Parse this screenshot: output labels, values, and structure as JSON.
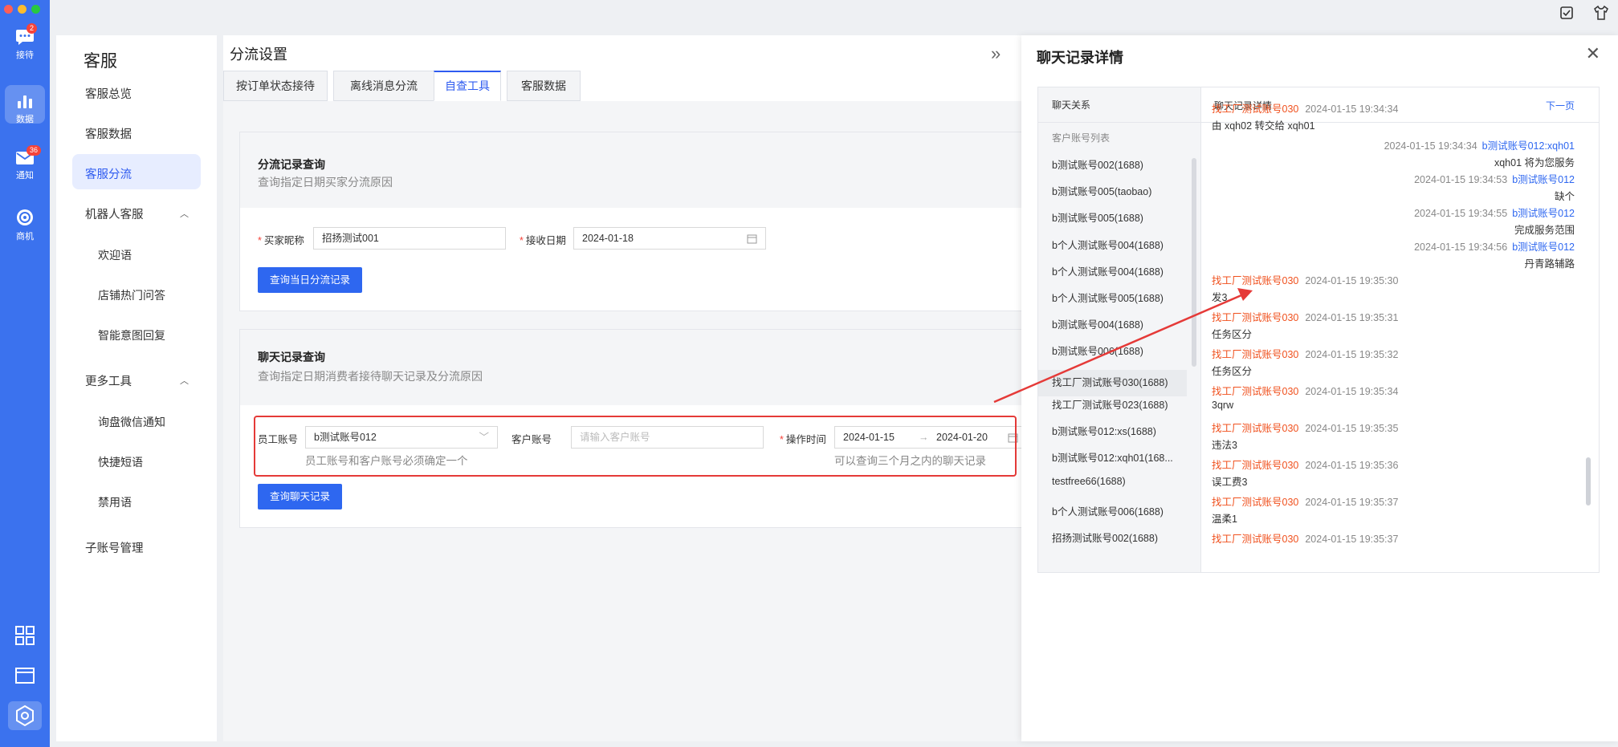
{
  "rail": {
    "items": [
      {
        "label": "接待",
        "badge": "2",
        "icon": "chat-icon"
      },
      {
        "label": "数据",
        "badge": "",
        "icon": "bar-chart-icon"
      },
      {
        "label": "通知",
        "badge": "36",
        "icon": "mail-icon"
      },
      {
        "label": "商机",
        "badge": "",
        "icon": "target-icon"
      }
    ],
    "bottom_icons": [
      "grid-icon",
      "window-icon",
      "hexagon-settings-icon"
    ]
  },
  "colors": {
    "accent": "#2e67f0",
    "rail": "#3b72ee",
    "highlight": "#e53a38",
    "orange": "#f0511e"
  },
  "sidebar": {
    "title": "客服",
    "items": [
      "客服总览",
      "客服数据",
      "客服分流",
      "机器人客服",
      "欢迎语",
      "店铺热门问答",
      "智能意图回复",
      "更多工具",
      "询盘微信通知",
      "快捷短语",
      "禁用语",
      "子账号管理"
    ]
  },
  "main": {
    "title": "分流设置",
    "tabs": [
      "按订单状态接待",
      "离线消息分流",
      "自查工具",
      "客服数据"
    ],
    "card1": {
      "title": "分流记录查询",
      "subtitle": "查询指定日期买家分流原因",
      "nick_label": "买家昵称",
      "nick_value": "招扬测试001",
      "date_label": "接收日期",
      "date_value": "2024-01-18",
      "button": "查询当日分流记录"
    },
    "card2": {
      "title": "聊天记录查询",
      "subtitle": "查询指定日期消费者接待聊天记录及分流原因",
      "staff_label": "员工账号",
      "staff_value": "b测试账号012",
      "customer_label": "客户账号",
      "customer_placeholder": "请输入客户账号",
      "time_label": "操作时间",
      "start": "2024-01-15",
      "end": "2024-01-20",
      "hint1": "员工账号和客户账号必须确定一个",
      "hint2": "可以查询三个月之内的聊天记录",
      "button": "查询聊天记录"
    }
  },
  "panel": {
    "title": "聊天记录详情",
    "left_header": "聊天关系",
    "right_header": "聊天记录详情",
    "next": "下一页",
    "list_title": "客户账号列表",
    "accounts": [
      "b测试账号002(1688)",
      "b测试账号005(taobao)",
      "b测试账号005(1688)",
      "b个人测试账号004(1688)",
      "b个人测试账号004(1688)",
      "b个人测试账号005(1688)",
      "b测试账号004(1688)",
      "b测试账号006(1688)",
      "找工厂测试账号030(1688)",
      "找工厂测试账号023(1688)",
      "b测试账号012:xs(1688)",
      "b测试账号012:xqh01(168...",
      "testfree66(1688)",
      "b个人测试账号006(1688)",
      "招扬测试账号002(1688)"
    ],
    "messages": [
      {
        "side": "left",
        "sender": "找工厂测试账号030",
        "time": "2024-01-15 19:34:34",
        "text": "由 xqh02 转交给 xqh01"
      },
      {
        "side": "right",
        "sender": "b测试账号012:xqh01",
        "time": "2024-01-15 19:34:34",
        "text": "xqh01 将为您服务"
      },
      {
        "side": "right",
        "sender": "b测试账号012",
        "time": "2024-01-15 19:34:53",
        "text": "缺个"
      },
      {
        "side": "right",
        "sender": "b测试账号012",
        "time": "2024-01-15 19:34:55",
        "text": "完成服务范围"
      },
      {
        "side": "right",
        "sender": "b测试账号012",
        "time": "2024-01-15 19:34:56",
        "text": "丹青路辅路"
      },
      {
        "side": "left",
        "sender": "找工厂测试账号030",
        "time": "2024-01-15 19:35:30",
        "text": "发3"
      },
      {
        "side": "left",
        "sender": "找工厂测试账号030",
        "time": "2024-01-15 19:35:31",
        "text": "任务区分"
      },
      {
        "side": "left",
        "sender": "找工厂测试账号030",
        "time": "2024-01-15 19:35:32",
        "text": "任务区分"
      },
      {
        "side": "left",
        "sender": "找工厂测试账号030",
        "time": "2024-01-15 19:35:34",
        "text": "3qrw"
      },
      {
        "side": "left",
        "sender": "找工厂测试账号030",
        "time": "2024-01-15 19:35:35",
        "text": "违法3"
      },
      {
        "side": "left",
        "sender": "找工厂测试账号030",
        "time": "2024-01-15 19:35:36",
        "text": "误工费3"
      },
      {
        "side": "left",
        "sender": "找工厂测试账号030",
        "time": "2024-01-15 19:35:37",
        "text": "温柔1"
      },
      {
        "side": "left",
        "sender": "找工厂测试账号030",
        "time": "2024-01-15 19:35:37",
        "text": ""
      }
    ]
  }
}
